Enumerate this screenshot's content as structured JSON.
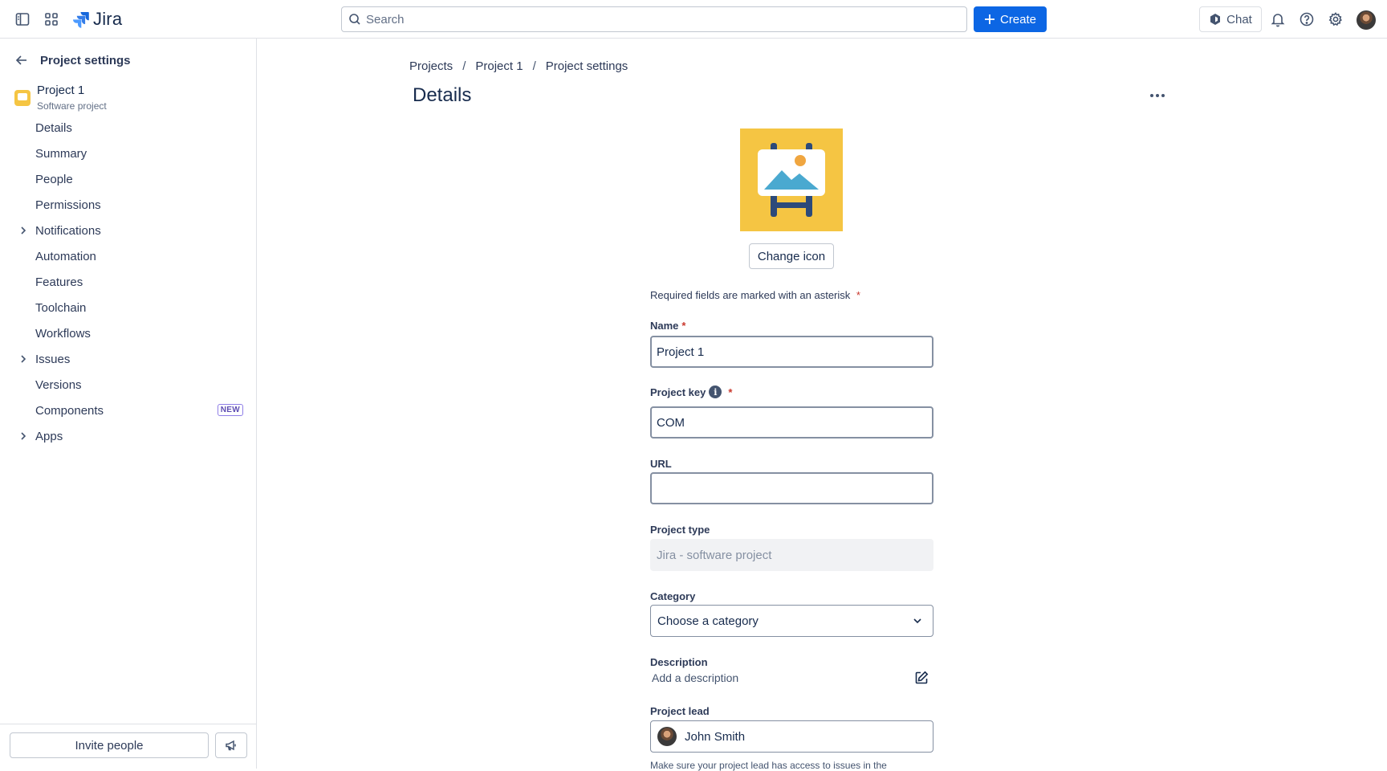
{
  "app": {
    "name": "Jira"
  },
  "topbar": {
    "search_placeholder": "Search",
    "create_label": "Create",
    "chat_label": "Chat"
  },
  "sidebar": {
    "title": "Project settings",
    "project": {
      "name": "Project 1",
      "type": "Software project"
    },
    "items": [
      {
        "label": "Details",
        "expandable": false
      },
      {
        "label": "Summary",
        "expandable": false
      },
      {
        "label": "People",
        "expandable": false
      },
      {
        "label": "Permissions",
        "expandable": false
      },
      {
        "label": "Notifications",
        "expandable": true
      },
      {
        "label": "Automation",
        "expandable": false
      },
      {
        "label": "Features",
        "expandable": false
      },
      {
        "label": "Toolchain",
        "expandable": false
      },
      {
        "label": "Workflows",
        "expandable": false
      },
      {
        "label": "Issues",
        "expandable": true
      },
      {
        "label": "Versions",
        "expandable": false
      },
      {
        "label": "Components",
        "expandable": false,
        "badge": "NEW"
      },
      {
        "label": "Apps",
        "expandable": true
      }
    ],
    "invite_label": "Invite people"
  },
  "main": {
    "breadcrumb": [
      "Projects",
      "Project 1",
      "Project settings"
    ],
    "breadcrumb_sep": "/",
    "title": "Details",
    "more_label": "...",
    "change_icon_label": "Change icon",
    "required_note": "Required fields are marked with an asterisk",
    "asterisk": "*",
    "fields": {
      "name": {
        "label": "Name",
        "value": "Project 1"
      },
      "project_key": {
        "label": "Project key",
        "value": "COM",
        "info": "i"
      },
      "url": {
        "label": "URL",
        "value": ""
      },
      "project_type": {
        "label": "Project type",
        "value": "Jira - software project"
      },
      "category": {
        "label": "Category",
        "value": "Choose a category"
      },
      "description": {
        "label": "Description",
        "placeholder": "Add a description"
      },
      "project_lead": {
        "label": "Project lead",
        "value": "John Smith"
      }
    },
    "lead_helper": "Make sure your project lead has access to issues in the"
  },
  "colors": {
    "primary": "#0c66e4",
    "project_icon_bg": "#f5c543",
    "required": "#c9372c",
    "badge_new": "#5e4db2"
  }
}
